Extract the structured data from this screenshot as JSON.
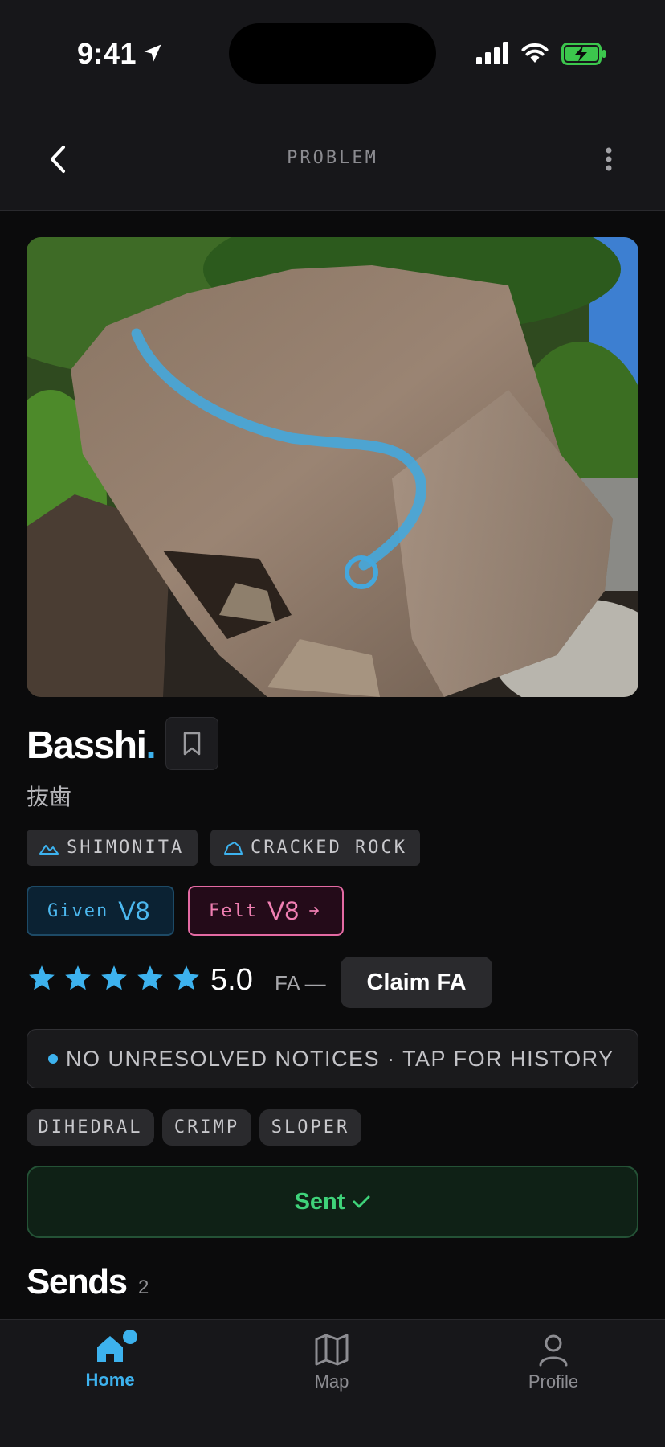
{
  "status_bar": {
    "time": "9:41"
  },
  "header": {
    "title": "PROBLEM",
    "back_icon": "chevron-left-icon",
    "menu_icon": "more-vertical-icon"
  },
  "photo": {
    "description_icon": "boulder-photo-with-route-line"
  },
  "problem": {
    "name": "Basshi",
    "name_accent": ".",
    "subtitle": "抜歯",
    "area": "SHIMONITA",
    "boulder": "CRACKED ROCK"
  },
  "grades": {
    "given_label": "Given",
    "given_value": "V8",
    "felt_label": "Felt",
    "felt_value": "V8"
  },
  "rating": {
    "stars": 5,
    "value": "5.0"
  },
  "first_ascent": {
    "label": "FA —",
    "claim_label": "Claim FA"
  },
  "notices": {
    "text": "NO UNRESOLVED NOTICES · TAP FOR HISTORY"
  },
  "tags": [
    "DIHEDRAL",
    "CRIMP",
    "SLOPER"
  ],
  "sent_button": {
    "label": "Sent"
  },
  "sends": {
    "title": "Sends",
    "count": "2"
  },
  "tabbar": {
    "home": "Home",
    "map": "Map",
    "profile": "Profile"
  },
  "colors": {
    "accent": "#3db2ee",
    "felt": "#f07fb2",
    "sent": "#3fd37a",
    "background": "#0b0b0c"
  }
}
